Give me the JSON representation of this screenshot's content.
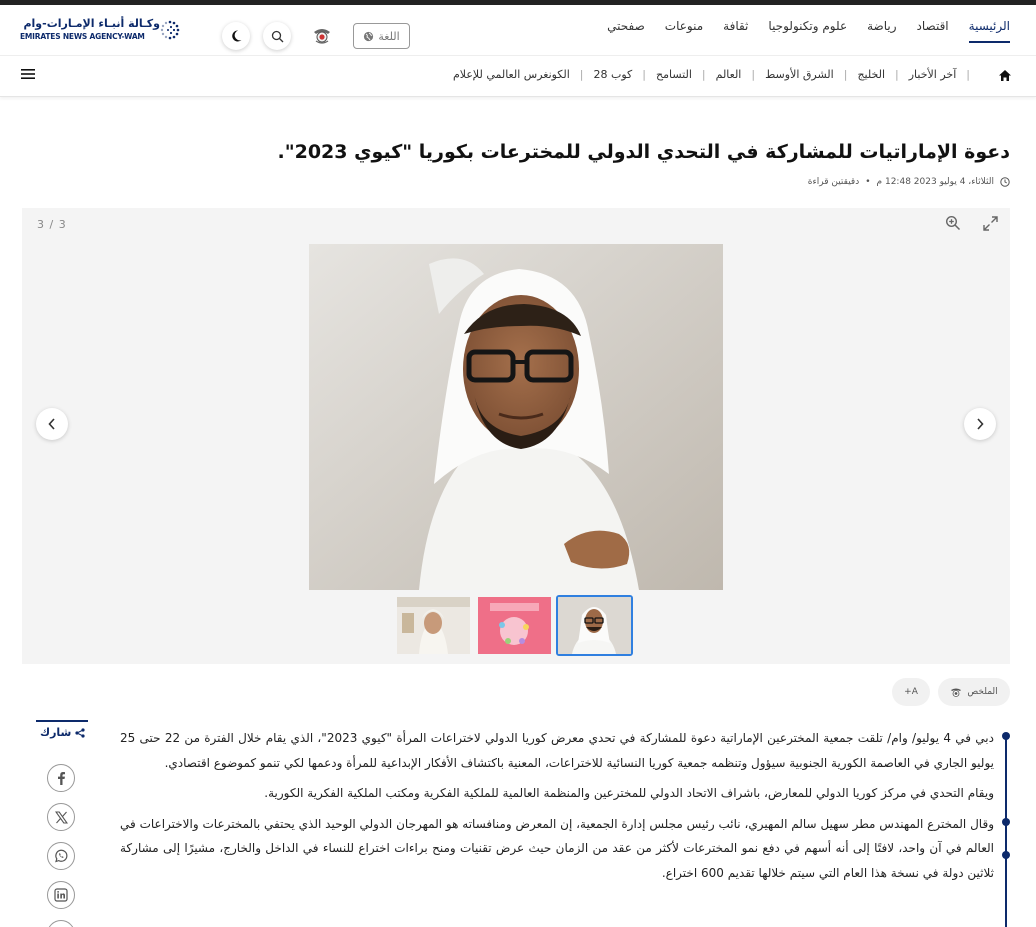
{
  "brand": {
    "name_ar": "وكـالة أنبـاء الإمـارات-وام",
    "name_en": "EMIRATES NEWS AGENCY-WAM"
  },
  "header": {
    "lang_label": "اللغة",
    "main_nav": [
      "الرئيسية",
      "اقتصاد",
      "رياضة",
      "علوم وتكنولوجيا",
      "ثقافة",
      "منوعات",
      "صفحتي"
    ]
  },
  "subnav": {
    "items": [
      "آخر الأخبار",
      "الخليج",
      "الشرق الأوسط",
      "العالم",
      "التسامح",
      "كوب 28",
      "الكونغرس العالمي للإعلام"
    ]
  },
  "article": {
    "title": "دعوة الإماراتيات للمشاركة في التحدي الدولي للمخترعات بكوريا \"كيوي 2023\".",
    "date": "الثلاثاء، 4 يوليو 2023 12:48 م",
    "read_time": "دقيقتين قراءة",
    "paragraphs": [
      "دبي في 4 يوليو/ وام/ تلقت جمعية المخترعين الإماراتية دعوة للمشاركة في تحدي معرض كوريا الدولي لاختراعات المرأة \"كيوي 2023\"، الذي يقام خلال الفترة من 22 حتى 25 يوليو الجاري في العاصمة الكورية الجنوبية سيؤول وتنظمه جمعية كوريا النسائية للاختراعات، المعنية باكتشاف الأفكار الإبداعية للمرأة ودعمها لكي تنمو كموضوع اقتصادي.",
      "ويقام التحدي في مركز كوريا الدولي للمعارض، باشراف الاتحاد الدولي للمخترعين والمنظمة العالمية للملكية الفكرية ومكتب الملكية الفكرية الكورية.",
      "وقال المخترع المهندس مطر سهيل سالم المهيري، نائب رئيس مجلس إدارة الجمعية، إن المعرض ومنافساته هو المهرجان الدولي الوحيد الذي يحتفي بالمخترعات والاختراعات في العالم في آن واحد، لافتًا إلى أنه أسهم في دفع نمو المخترعات لأكثر من عقد من الزمان حيث عرض تقنيات ومنح براءات اختراع للنساء في الداخل والخارج، مشيرًا إلى مشاركة ثلاثين دولة في نسخة هذا العام التي سيتم خلالها تقديم 600 اختراع."
    ]
  },
  "gallery": {
    "counter": "3 / 3",
    "image_count": 3,
    "current": 3
  },
  "tools": {
    "summary_label": "الملخص",
    "font_label": "A+"
  },
  "share": {
    "label": "شارك",
    "networks": [
      "facebook-icon",
      "x-icon",
      "whatsapp-icon",
      "linkedin-icon",
      "email-icon"
    ]
  },
  "colors": {
    "brand_navy": "#0d2a6b",
    "active_thumb_border": "#2f7fe0",
    "gallery_bg": "#f4f4f4"
  }
}
